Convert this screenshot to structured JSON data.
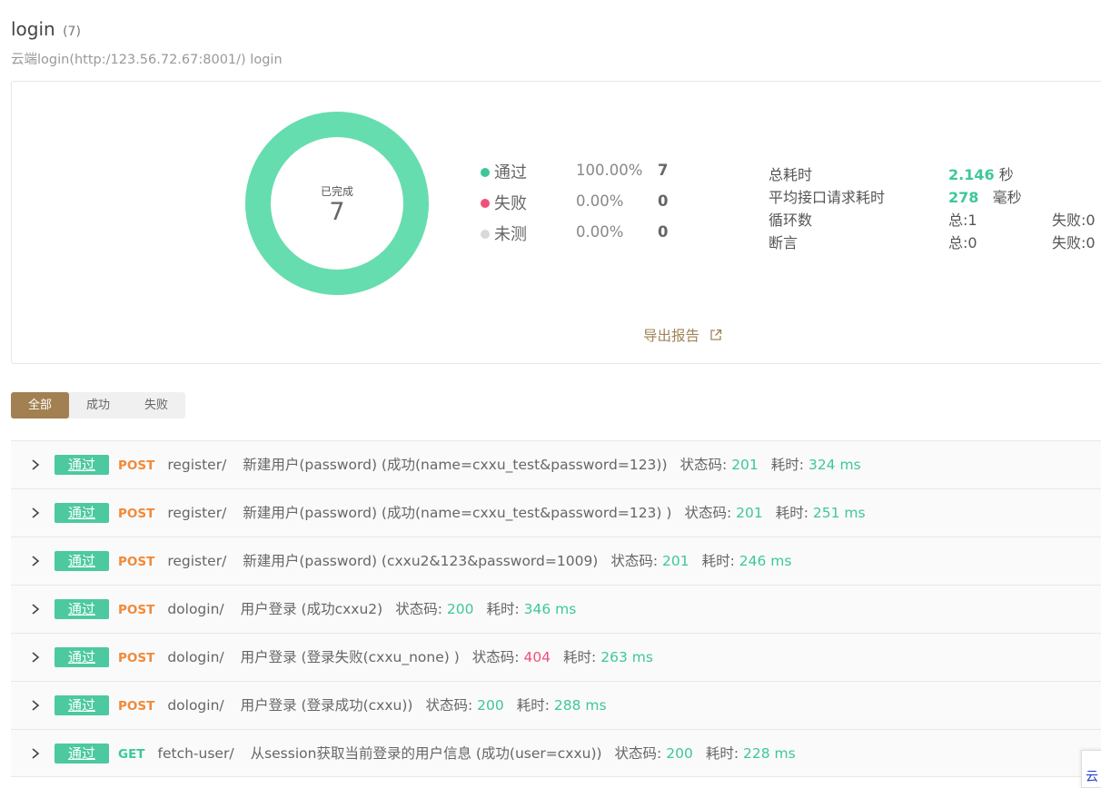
{
  "header": {
    "title": "login",
    "count": "(7)",
    "subtitle": "云端login(http:/123.56.72.67:8001/) login"
  },
  "summary": {
    "donut_label": "已完成",
    "donut_value": "7",
    "pass_fraction": 1.0,
    "legend": [
      {
        "label": "通过",
        "pct": "100.00%",
        "count": "7",
        "color": "#3ec897"
      },
      {
        "label": "失败",
        "pct": "0.00%",
        "count": "0",
        "color": "#f0507a"
      },
      {
        "label": "未测",
        "pct": "0.00%",
        "count": "0",
        "color": "#d9d9d9"
      }
    ],
    "stats": {
      "total_time_label": "总耗时",
      "total_time_value": "2.146",
      "total_time_unit": "秒",
      "avg_time_label": "平均接口请求耗时",
      "avg_time_value": "278",
      "avg_time_unit": "毫秒",
      "loop_label": "循环数",
      "loop_total": "总:1",
      "loop_failed": "失败:0",
      "assert_label": "断言",
      "assert_total": "总:0",
      "assert_failed": "失败:0"
    },
    "export_label": "导出报告"
  },
  "tabs": [
    {
      "label": "全部",
      "active": true
    },
    {
      "label": "成功",
      "active": false
    },
    {
      "label": "失败",
      "active": false
    }
  ],
  "results": [
    {
      "status": "通过",
      "method": "POST",
      "path": "register/",
      "desc": "新建用户(password) (成功(name=cxxu_test&password=123))",
      "code_label": "状态码:",
      "code": "201",
      "time_label": "耗时:",
      "time": "324 ms"
    },
    {
      "status": "通过",
      "method": "POST",
      "path": "register/",
      "desc": "新建用户(password) (成功(name=cxxu_test&password=123) )",
      "code_label": "状态码:",
      "code": "201",
      "time_label": "耗时:",
      "time": "251 ms"
    },
    {
      "status": "通过",
      "method": "POST",
      "path": "register/",
      "desc": "新建用户(password) (cxxu2&123&password=1009)",
      "code_label": "状态码:",
      "code": "201",
      "time_label": "耗时:",
      "time": "246 ms"
    },
    {
      "status": "通过",
      "method": "POST",
      "path": "dologin/",
      "desc": "用户登录 (成功cxxu2)",
      "code_label": "状态码:",
      "code": "200",
      "time_label": "耗时:",
      "time": "346 ms"
    },
    {
      "status": "通过",
      "method": "POST",
      "path": "dologin/",
      "desc": "用户登录 (登录失败(cxxu_none) )",
      "code_label": "状态码:",
      "code": "404",
      "time_label": "耗时:",
      "time": "263 ms"
    },
    {
      "status": "通过",
      "method": "POST",
      "path": "dologin/",
      "desc": "用户登录 (登录成功(cxxu))",
      "code_label": "状态码:",
      "code": "200",
      "time_label": "耗时:",
      "time": "288 ms"
    },
    {
      "status": "通过",
      "method": "GET",
      "path": "fetch-user/",
      "desc": "从session获取当前登录的用户信息 (成功(user=cxxu))",
      "code_label": "状态码:",
      "code": "200",
      "time_label": "耗时:",
      "time": "228 ms"
    }
  ],
  "corner_widget": {
    "text": "云"
  }
}
